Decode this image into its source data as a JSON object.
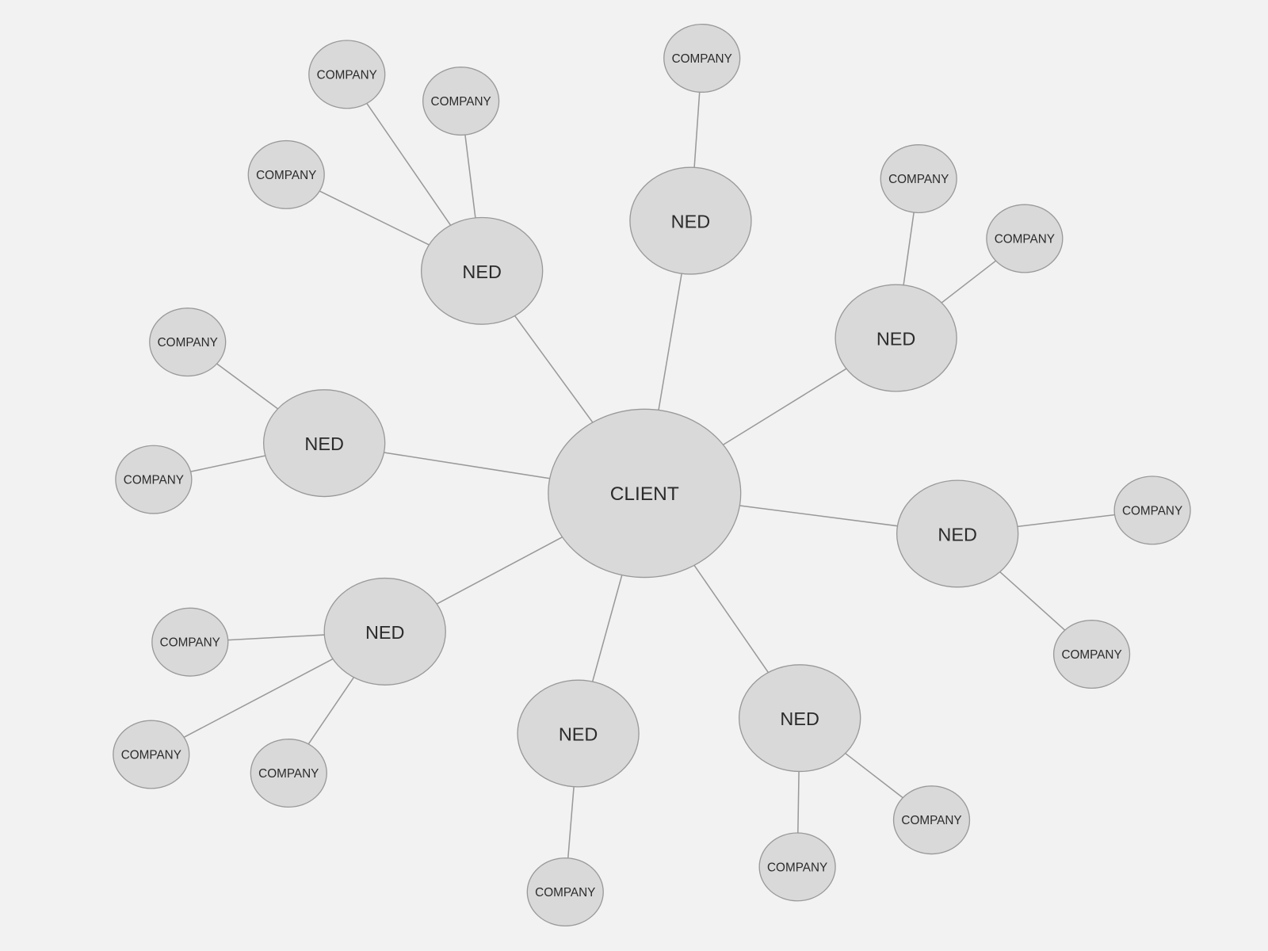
{
  "diagram": {
    "type": "hub-and-spoke",
    "center": {
      "label": "CLIENT"
    },
    "neds": [
      {
        "label": "NED",
        "companies": [
          "COMPANY",
          "COMPANY",
          "COMPANY"
        ]
      },
      {
        "label": "NED",
        "companies": [
          "COMPANY"
        ]
      },
      {
        "label": "NED",
        "companies": [
          "COMPANY",
          "COMPANY"
        ]
      },
      {
        "label": "NED",
        "companies": [
          "COMPANY",
          "COMPANY"
        ]
      },
      {
        "label": "NED",
        "companies": [
          "COMPANY",
          "COMPANY"
        ]
      },
      {
        "label": "NED",
        "companies": [
          "COMPANY"
        ]
      },
      {
        "label": "NED",
        "companies": [
          "COMPANY",
          "COMPANY",
          "COMPANY"
        ]
      },
      {
        "label": "NED",
        "companies": [
          "COMPANY",
          "COMPANY"
        ]
      }
    ]
  }
}
